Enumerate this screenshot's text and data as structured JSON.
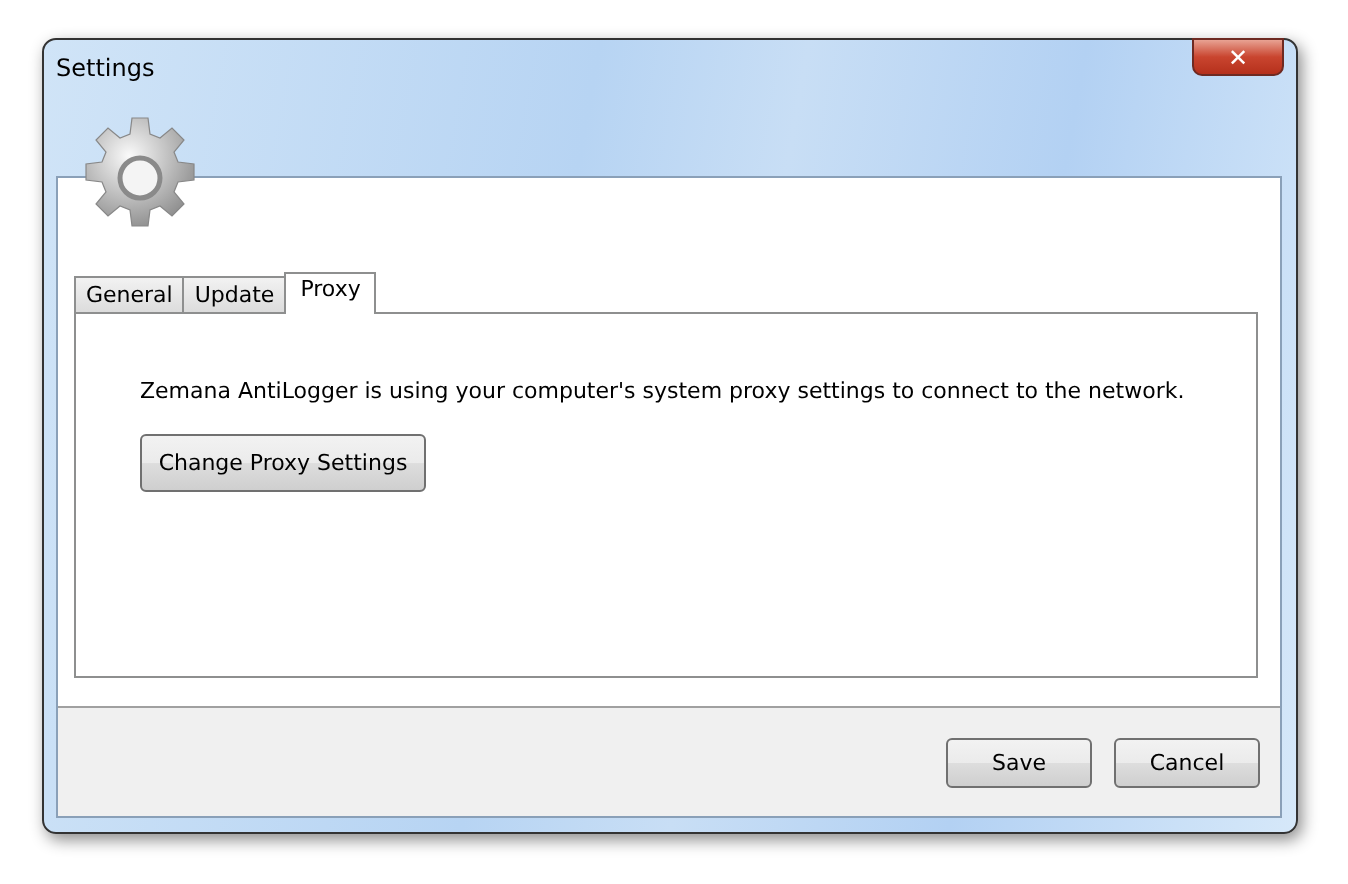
{
  "window": {
    "title": "Settings",
    "close": "✕"
  },
  "tabs": [
    {
      "label": "General",
      "selected": false
    },
    {
      "label": "Update",
      "selected": false
    },
    {
      "label": "Proxy",
      "selected": true
    }
  ],
  "proxy": {
    "message": "Zemana AntiLogger is using your computer's system proxy settings to connect to the network.",
    "button": "Change Proxy Settings"
  },
  "buttons": [
    "Save",
    "Cancel"
  ]
}
